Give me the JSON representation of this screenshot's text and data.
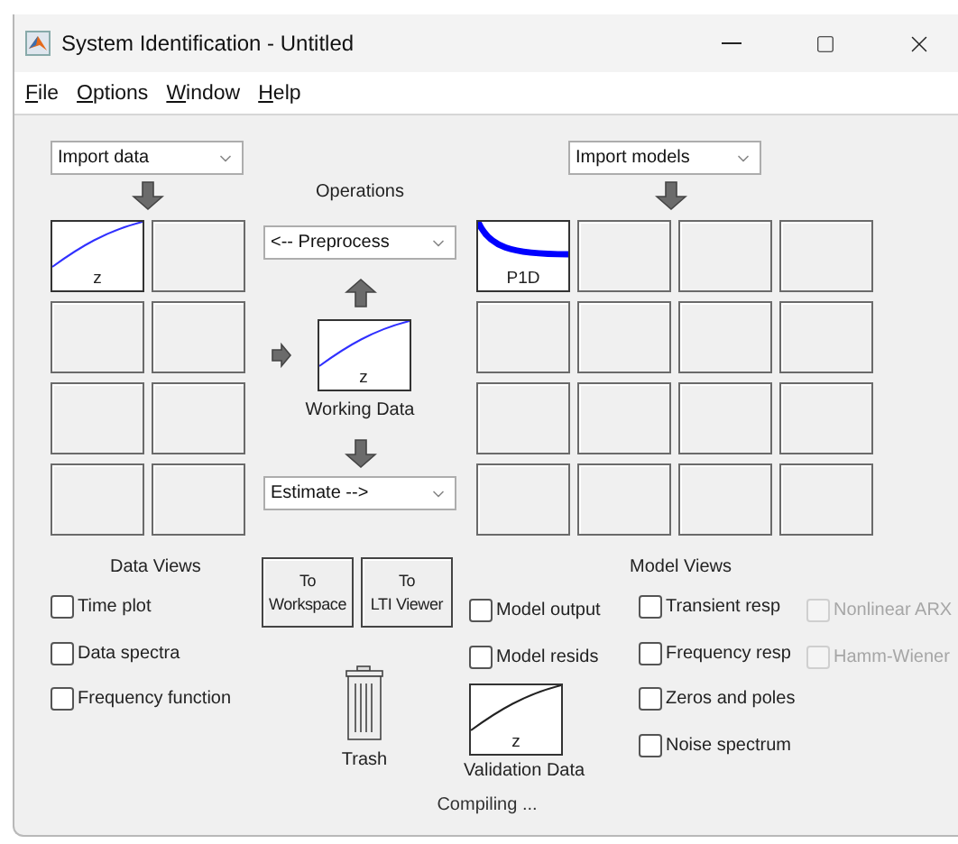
{
  "window": {
    "title": "System Identification - Untitled"
  },
  "menu": [
    "File",
    "Options",
    "Window",
    "Help"
  ],
  "import_data": {
    "value": "Import data"
  },
  "data_board": [
    {
      "kind": "data",
      "label": "z"
    },
    {
      "kind": "empty"
    },
    {
      "kind": "empty"
    },
    {
      "kind": "empty"
    },
    {
      "kind": "empty"
    },
    {
      "kind": "empty"
    },
    {
      "kind": "empty"
    },
    {
      "kind": "empty"
    }
  ],
  "operations": {
    "title": "Operations",
    "preprocess": "<-- Preprocess",
    "working_data": {
      "label": "z",
      "caption": "Working Data"
    },
    "estimate": "Estimate -->"
  },
  "import_models": {
    "value": "Import models"
  },
  "model_board": [
    {
      "kind": "model",
      "label": "P1D"
    },
    {
      "kind": "empty"
    },
    {
      "kind": "empty"
    },
    {
      "kind": "empty"
    },
    {
      "kind": "empty"
    },
    {
      "kind": "empty"
    },
    {
      "kind": "empty"
    },
    {
      "kind": "empty"
    },
    {
      "kind": "empty"
    },
    {
      "kind": "empty"
    },
    {
      "kind": "empty"
    },
    {
      "kind": "empty"
    },
    {
      "kind": "empty"
    },
    {
      "kind": "empty"
    },
    {
      "kind": "empty"
    },
    {
      "kind": "empty"
    }
  ],
  "data_views": {
    "title": "Data Views",
    "items": [
      {
        "label": "Time plot",
        "checked": false
      },
      {
        "label": "Data spectra",
        "checked": false
      },
      {
        "label": "Frequency function",
        "checked": false
      }
    ]
  },
  "buttons": [
    "To Workspace",
    "To LTI Viewer"
  ],
  "trash": {
    "label": "Trash"
  },
  "model_checks": [
    {
      "label": "Model output",
      "checked": false
    },
    {
      "label": "Model resids",
      "checked": false
    }
  ],
  "validation_data": {
    "label": "z",
    "caption": "Validation Data"
  },
  "model_views": {
    "title": "Model Views",
    "items": [
      {
        "label": "Transient resp",
        "checked": false,
        "disabled": false
      },
      {
        "label": "Frequency resp",
        "checked": false,
        "disabled": false
      },
      {
        "label": "Zeros and poles",
        "checked": false,
        "disabled": false
      },
      {
        "label": "Noise spectrum",
        "checked": false,
        "disabled": false
      }
    ],
    "extra_items": [
      {
        "label": "Nonlinear ARX",
        "checked": false,
        "disabled": true
      },
      {
        "label": "Hamm-Wiener",
        "checked": false,
        "disabled": true
      }
    ]
  },
  "status": "Compiling ..."
}
